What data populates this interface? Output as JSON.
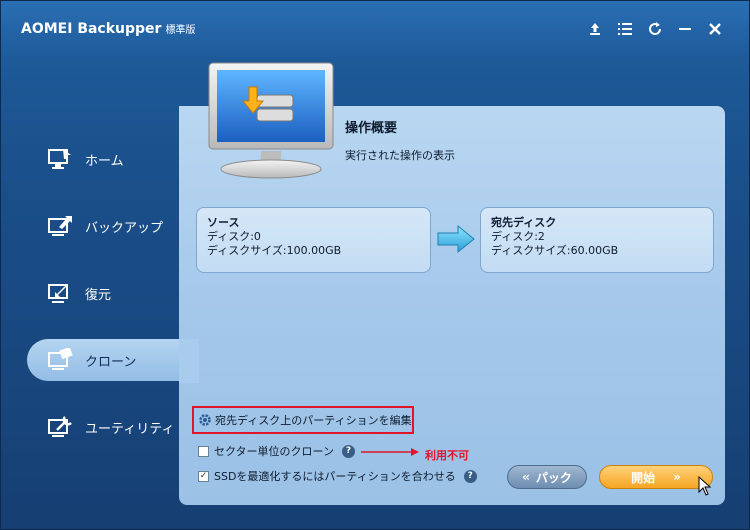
{
  "window": {
    "title": "AOMEI Backupper",
    "edition": "標準版"
  },
  "titlebar_icons": [
    "upgrade-icon",
    "menu-icon",
    "refresh-icon",
    "minimize-icon",
    "close-icon"
  ],
  "sidebar": {
    "items": [
      {
        "label": "ホーム",
        "icon": "home-icon",
        "active": false
      },
      {
        "label": "バックアップ",
        "icon": "backup-icon",
        "active": false
      },
      {
        "label": "復元",
        "icon": "restore-icon",
        "active": false
      },
      {
        "label": "クローン",
        "icon": "clone-icon",
        "active": true
      },
      {
        "label": "ユーティリティ",
        "icon": "utilities-icon",
        "active": false
      }
    ]
  },
  "main": {
    "title": "操作概要",
    "subtitle": "実行された操作の表示",
    "source": {
      "heading": "ソース",
      "disk": "ディスク:0",
      "size": "ディスクサイズ:100.00GB"
    },
    "destination": {
      "heading": "宛先ディスク",
      "disk": "ディスク:2",
      "size": "ディスクサイズ:60.00GB"
    },
    "edit_partitions": "宛先ディスク上のパーティションを編集",
    "options": {
      "sector_clone": {
        "label": "セクター単位のクローン",
        "checked": false
      },
      "ssd_align": {
        "label": "SSDを最適化するにはパーティションを合わせる",
        "checked": true
      }
    },
    "annotation": "利用不可",
    "back_button": "パック",
    "start_button": "開始"
  },
  "colors": {
    "accent_red": "#e0142a",
    "start_orange": "#f5a623"
  }
}
